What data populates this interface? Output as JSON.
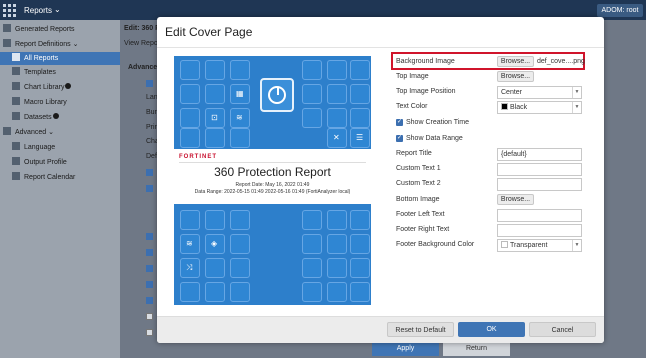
{
  "topbar": {
    "app_title": "Reports",
    "adom_label": "ADOM: root"
  },
  "sidebar": {
    "items": [
      {
        "label": "Generated Reports"
      },
      {
        "label": "Report Definitions"
      },
      {
        "label": "All Reports"
      },
      {
        "label": "Templates"
      },
      {
        "label": "Chart Library"
      },
      {
        "label": "Macro Library"
      },
      {
        "label": "Datasets"
      },
      {
        "label": "Advanced"
      },
      {
        "label": "Language"
      },
      {
        "label": "Output Profile"
      },
      {
        "label": "Report Calendar"
      }
    ]
  },
  "background": {
    "header": "Edit: 360 P",
    "view_report": "View Repor",
    "advanced": "Advanced",
    "rows": [
      "Lan",
      "Bun",
      "Prin",
      "Cha",
      "Def"
    ],
    "apply_label": "Apply",
    "return_label": "Return"
  },
  "modal": {
    "title": "Edit Cover Page",
    "preview": {
      "brand": "FORTINET",
      "title": "360 Protection Report",
      "report_date": "Report Date: May 16, 2022 01:49",
      "data_range": "Data Range: 2022-05-15 01:49 2022-05-16 01:49 (FortiAnalyzer local)"
    },
    "fields": {
      "background_image": {
        "label": "Background Image",
        "button": "Browse...",
        "file": "def_cove....png"
      },
      "top_image": {
        "label": "Top Image",
        "button": "Browse..."
      },
      "top_image_position": {
        "label": "Top Image Position",
        "value": "Center"
      },
      "text_color": {
        "label": "Text Color",
        "value": "Black"
      },
      "show_creation_time": {
        "label": "Show Creation Time"
      },
      "show_data_range": {
        "label": "Show Data Range"
      },
      "report_title": {
        "label": "Report Title",
        "value": "{default}"
      },
      "custom_text_1": {
        "label": "Custom Text 1",
        "value": ""
      },
      "custom_text_2": {
        "label": "Custom Text 2",
        "value": ""
      },
      "bottom_image": {
        "label": "Bottom Image",
        "button": "Browse..."
      },
      "footer_left_text": {
        "label": "Footer Left Text",
        "value": ""
      },
      "footer_right_text": {
        "label": "Footer Right Text",
        "value": ""
      },
      "footer_background_color": {
        "label": "Footer Background Color",
        "value": "Transparent"
      }
    },
    "buttons": {
      "reset": "Reset to Default",
      "ok": "OK",
      "cancel": "Cancel"
    }
  },
  "colors": {
    "accent": "#3f75b5",
    "highlight": "#d0142b",
    "cover_blue": "#2d7fcb"
  }
}
